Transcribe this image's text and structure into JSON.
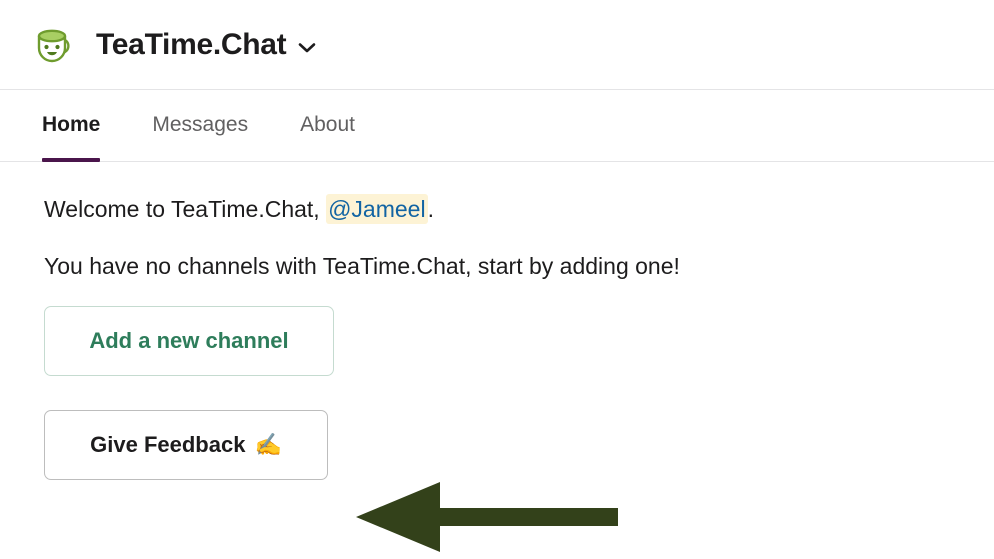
{
  "header": {
    "app_icon": "teacup-smiling-icon",
    "app_name": "TeaTime.Chat",
    "chevron": "chevron-down-icon"
  },
  "tabs": [
    {
      "label": "Home",
      "active": true
    },
    {
      "label": "Messages",
      "active": false
    },
    {
      "label": "About",
      "active": false
    }
  ],
  "main": {
    "welcome_prefix": "Welcome to TeaTime.Chat, ",
    "mention": "@Jameel",
    "welcome_suffix": ".",
    "no_channels_text": "You have no channels with TeaTime.Chat, start by adding one!",
    "add_channel_label": "Add a new channel",
    "feedback_label": "Give Feedback",
    "feedback_emoji": "✍️"
  },
  "annotation": {
    "arrow": "left-arrow-annotation",
    "color": "#33411a"
  },
  "colors": {
    "active_tab_underline": "#4a154b",
    "mention_background": "#fdf3d5",
    "mention_text": "#1264a3",
    "add_channel_text": "#2e7d5b",
    "add_channel_border": "#c5dbd0",
    "feedback_border": "#bdbdbd",
    "divider": "#e4e4e6",
    "arrow": "#33411a"
  }
}
